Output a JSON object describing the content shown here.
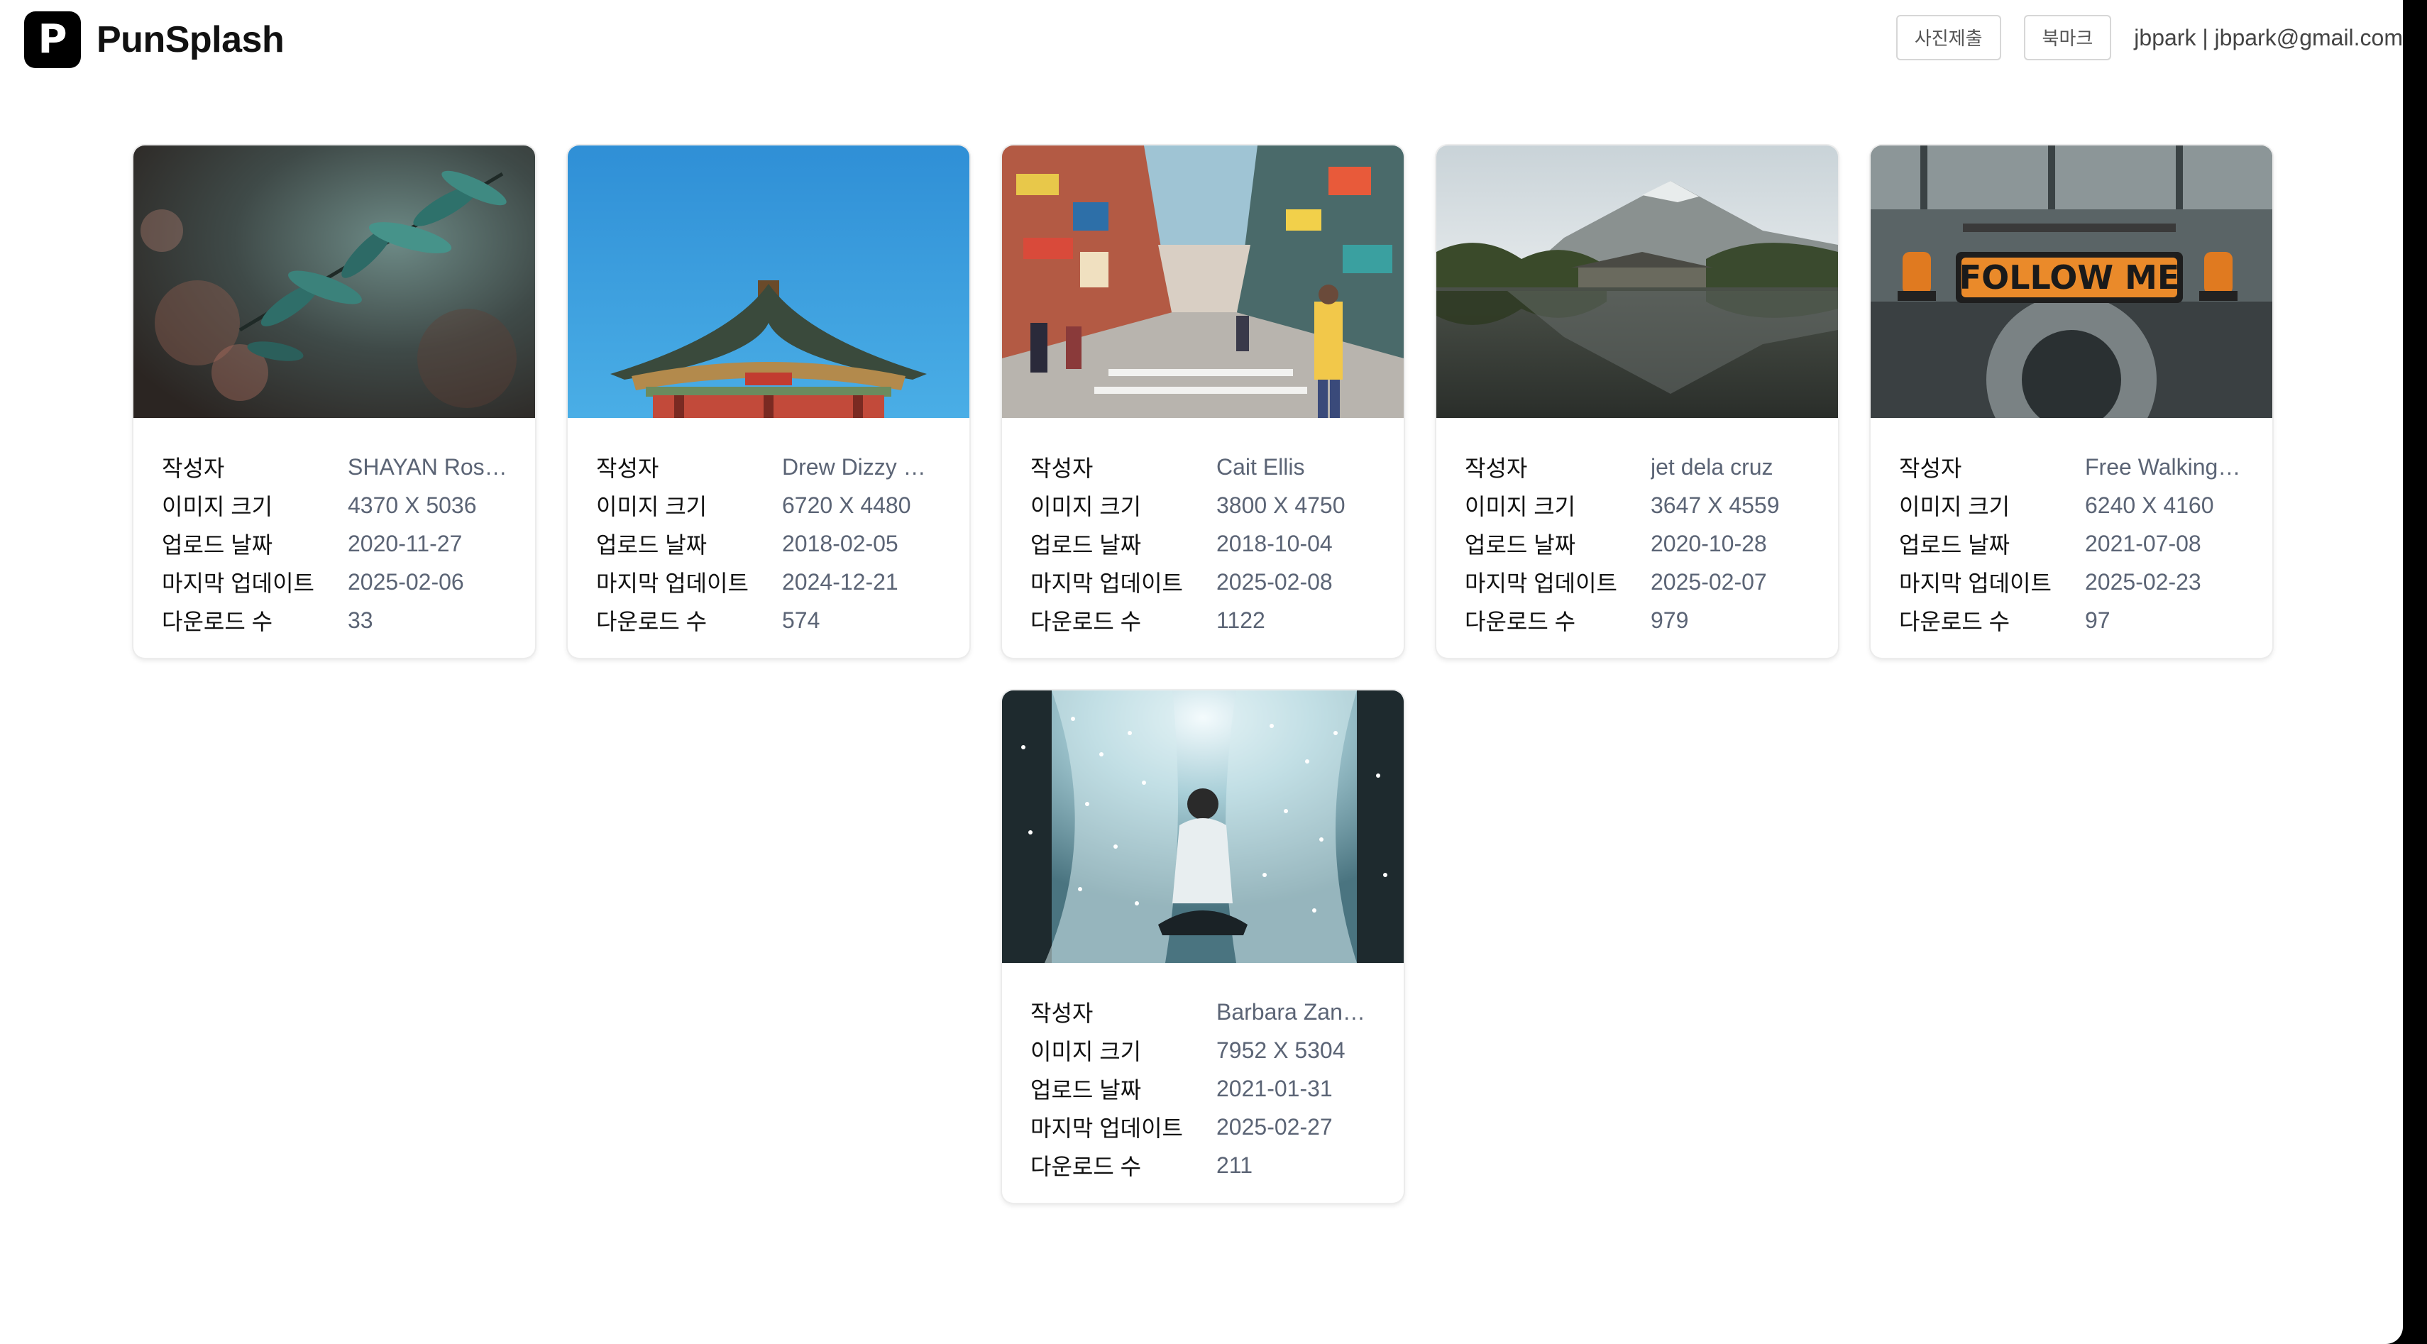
{
  "app": {
    "logo_letter": "P",
    "name": "PunSplash"
  },
  "header": {
    "submit_label": "사진제출",
    "bookmark_label": "북마크",
    "user": "jbpark | jbpark@gmail.com"
  },
  "labels": {
    "author": "작성자",
    "size": "이미지 크기",
    "uploaded": "업로드 날짜",
    "updated": "마지막 업데이트",
    "downloads": "다운로드 수"
  },
  "cards": [
    {
      "author": "SHAYAN Rostami",
      "size": "4370 X 5036",
      "uploaded": "2020-11-27",
      "updated": "2025-02-06",
      "downloads": "33",
      "photo": "leaves"
    },
    {
      "author": "Drew Dizzy Graham",
      "size": "6720 X 4480",
      "uploaded": "2018-02-05",
      "updated": "2024-12-21",
      "downloads": "574",
      "photo": "pagoda"
    },
    {
      "author": "Cait Ellis",
      "size": "3800 X 4750",
      "uploaded": "2018-10-04",
      "updated": "2025-02-08",
      "downloads": "1122",
      "photo": "street"
    },
    {
      "author": "jet dela cruz",
      "size": "3647 X 4559",
      "uploaded": "2020-10-28",
      "updated": "2025-02-07",
      "downloads": "979",
      "photo": "lake"
    },
    {
      "author": "Free Walking Tour",
      "size": "6240 X 4160",
      "uploaded": "2021-07-08",
      "updated": "2025-02-23",
      "downloads": "97",
      "photo": "follow-me",
      "sign_text": "FOLLOW ME"
    },
    {
      "author": "Barbara Zandoval",
      "size": "7952 X 5304",
      "uploaded": "2021-01-31",
      "updated": "2025-02-27",
      "downloads": "211",
      "photo": "curtain"
    }
  ]
}
